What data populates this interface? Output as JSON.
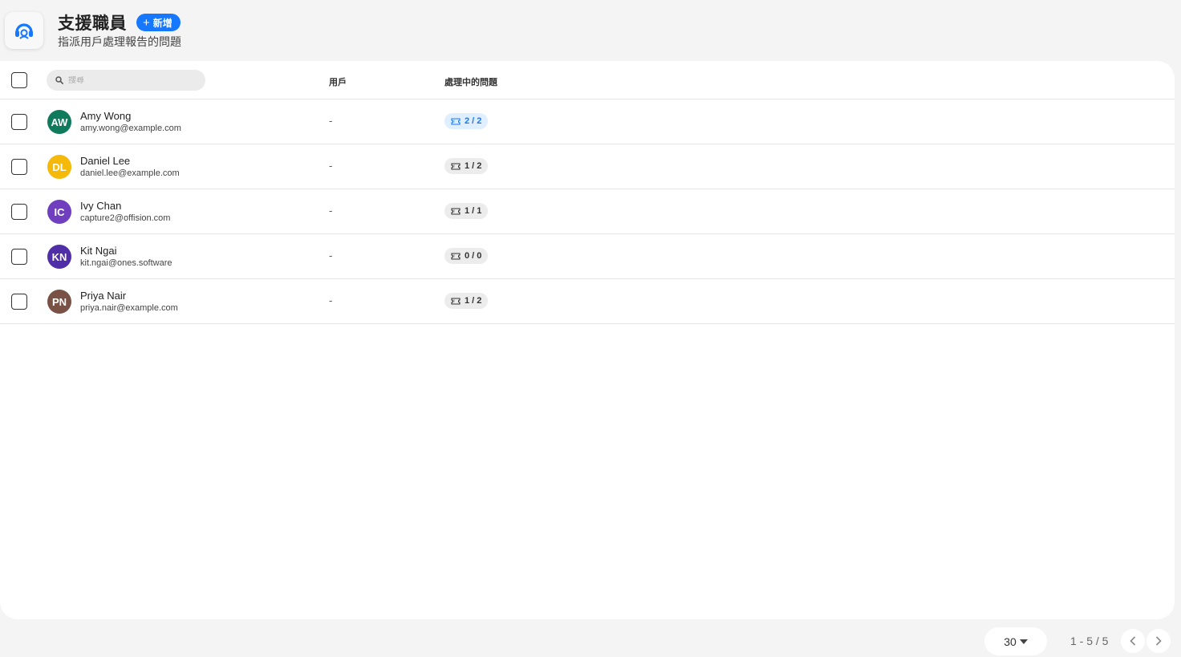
{
  "header": {
    "title": "支援職員",
    "add_label": "新增",
    "subtitle": "指派用戶處理報告的問題"
  },
  "table": {
    "search_placeholder": "搜尋",
    "columns": {
      "user": "用戶",
      "issues": "處理中的問題"
    },
    "rows": [
      {
        "initials": "AW",
        "avatar_color": "#0f7a5c",
        "name": "Amy Wong",
        "email": "amy.wong@example.com",
        "user": "-",
        "issues": "2 / 2",
        "issues_active": true
      },
      {
        "initials": "DL",
        "avatar_color": "#f5b90a",
        "name": "Daniel Lee",
        "email": "daniel.lee@example.com",
        "user": "-",
        "issues": "1 / 2",
        "issues_active": false
      },
      {
        "initials": "IC",
        "avatar_color": "#6f3fc0",
        "name": "Ivy Chan",
        "email": "capture2@offision.com",
        "user": "-",
        "issues": "1 / 1",
        "issues_active": false
      },
      {
        "initials": "KN",
        "avatar_color": "#4f2ea8",
        "name": "Kit Ngai",
        "email": "kit.ngai@ones.software",
        "user": "-",
        "issues": "0 / 0",
        "issues_active": false
      },
      {
        "initials": "PN",
        "avatar_color": "#7a5245",
        "name": "Priya Nair",
        "email": "priya.nair@example.com",
        "user": "-",
        "issues": "1 / 2",
        "issues_active": false
      }
    ]
  },
  "pagination": {
    "per_page": "30",
    "range": "1 - 5 / 5"
  },
  "colors": {
    "accent": "#1677ff",
    "badge_active_bg": "#e0efff"
  }
}
